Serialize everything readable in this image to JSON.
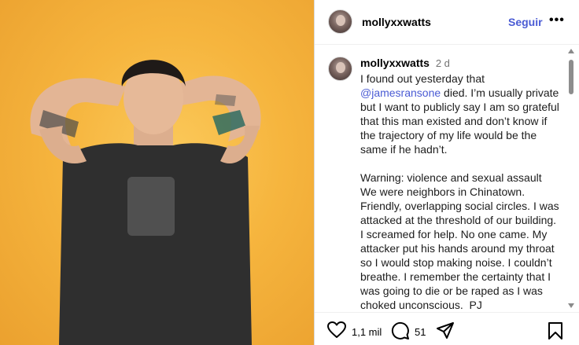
{
  "post": {
    "username": "mollyxxwatts",
    "follow_label": "Seguir",
    "more_label": "•••"
  },
  "comment": {
    "username": "mollyxxwatts",
    "time": "2 d",
    "text_before": "I found out yesterday that ",
    "mention": "@jamesransone",
    "text_after": " died. I’m usually private but I want to publicly say I am so grateful that this man existed and don’t know if the trajectory of my life would be the same if he hadn’t.\n\nWarning: violence and sexual assault\nWe were neighbors in Chinatown. Friendly, overlapping social circles. I was attacked at the threshold of our building. I screamed for help. No one came. My attacker put his hands around my throat so I would stop making noise. I couldn’t breathe. I remember the certainty that I was going to die or be raped as I was choked unconscious.  PJ"
  },
  "actions": {
    "likes": "1,1 mil",
    "comments": "51",
    "icons": [
      "heart-icon",
      "comment-icon",
      "share-icon",
      "bookmark-icon"
    ]
  },
  "colors": {
    "accent": "#4a5bd4",
    "background_photo": "#f6b53e"
  }
}
